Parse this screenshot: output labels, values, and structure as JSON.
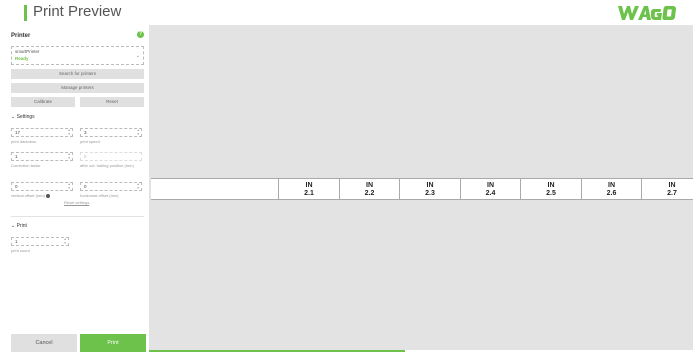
{
  "header": {
    "title": "Print Preview",
    "logo": "WAGO"
  },
  "colors": {
    "accent": "#6cc24a",
    "preview_bg": "#e3e3e3"
  },
  "printer": {
    "heading": "Printer",
    "help_icon": "question-icon",
    "selected_name": "smartPrinter",
    "selected_status": "Ready",
    "search_label": "Search for printers",
    "manage_label": "Manage printers",
    "calibrate_label": "Calibrate",
    "reset_label": "Reset"
  },
  "settings": {
    "heading": "Settings",
    "print_darkness": {
      "value": "17",
      "label": "print darkness"
    },
    "print_speed": {
      "value": "3",
      "label": "print speed"
    },
    "correction_factor": {
      "value": "1",
      "label": "Correction factor"
    },
    "after_cut": {
      "value": "0",
      "label": "after cut: trailing position (mm)"
    },
    "vertical_offset": {
      "value": "0",
      "label": "vertical offset (mm)"
    },
    "horizontal_offset": {
      "value": "0",
      "label": "horizontal offset (mm)"
    },
    "reset_settings": "Reset settings"
  },
  "print": {
    "heading": "Print",
    "print_count": {
      "value": "1",
      "label": "print count"
    }
  },
  "actions": {
    "cancel": "Cancel",
    "print": "Print"
  },
  "preview": {
    "markers": [
      {
        "line1": "IN",
        "line2": "2.1"
      },
      {
        "line1": "IN",
        "line2": "2.2"
      },
      {
        "line1": "IN",
        "line2": "2.3"
      },
      {
        "line1": "IN",
        "line2": "2.4"
      },
      {
        "line1": "IN",
        "line2": "2.5"
      },
      {
        "line1": "IN",
        "line2": "2.6"
      },
      {
        "line1": "IN",
        "line2": "2.7"
      }
    ]
  },
  "progress": {
    "fraction": 0.47
  }
}
